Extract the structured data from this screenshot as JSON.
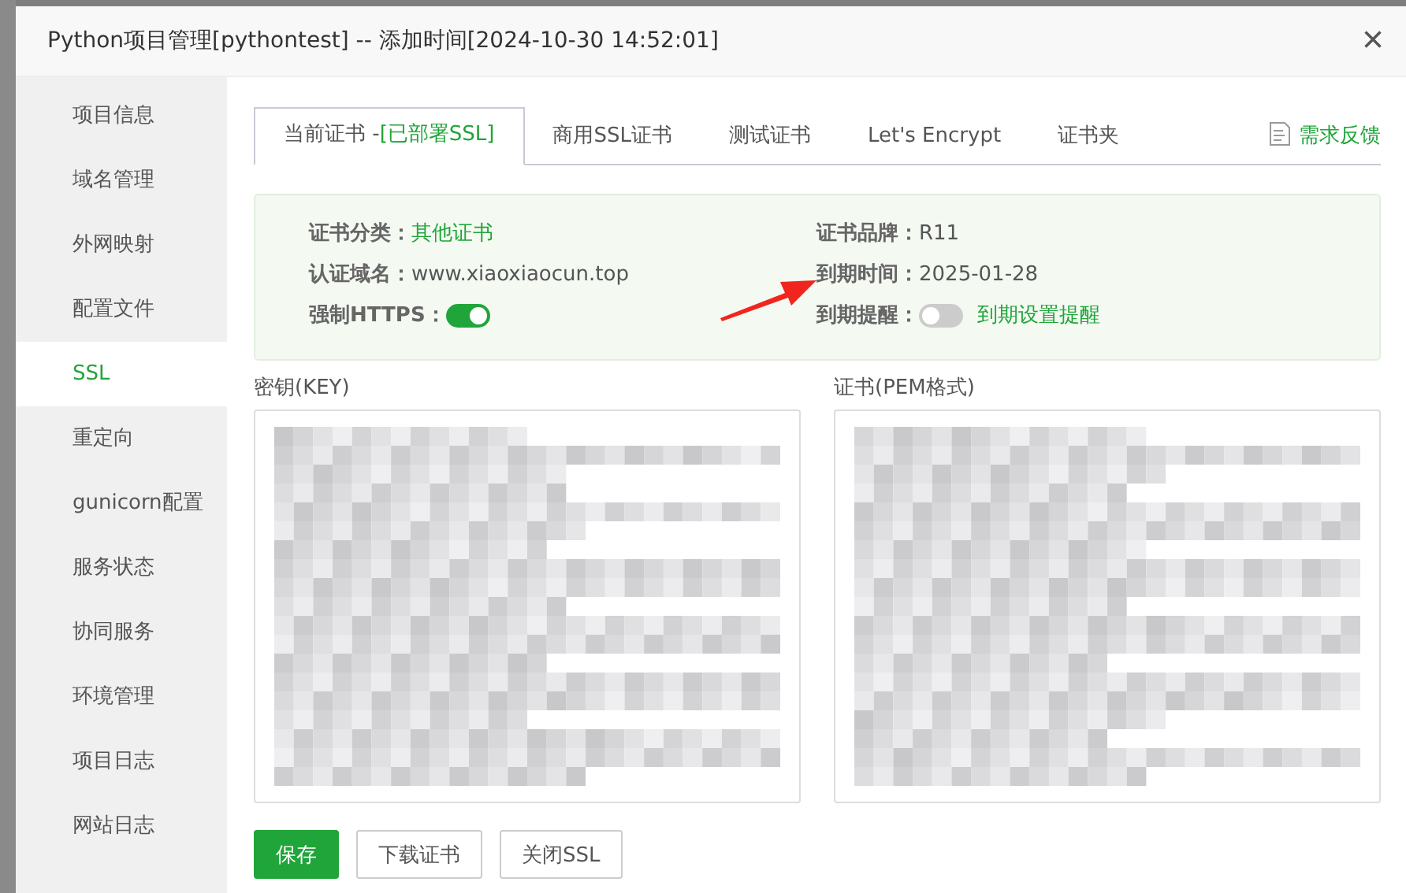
{
  "window": {
    "title": "Python项目管理[pythontest] -- 添加时间[2024-10-30 14:52:01]",
    "close": "×"
  },
  "sidebar": {
    "items": [
      {
        "label": "项目信息",
        "selected": false
      },
      {
        "label": "域名管理",
        "selected": false
      },
      {
        "label": "外网映射",
        "selected": false
      },
      {
        "label": "配置文件",
        "selected": false
      },
      {
        "label": "SSL",
        "selected": true
      },
      {
        "label": "重定向",
        "selected": false
      },
      {
        "label": "gunicorn配置",
        "selected": false
      },
      {
        "label": "服务状态",
        "selected": false
      },
      {
        "label": "协同服务",
        "selected": false
      },
      {
        "label": "环境管理",
        "selected": false
      },
      {
        "label": "项目日志",
        "selected": false
      },
      {
        "label": "网站日志",
        "selected": false
      }
    ]
  },
  "tabs": [
    {
      "label": "当前证书 -",
      "badge": "[已部署SSL]",
      "selected": true
    },
    {
      "label": "商用SSL证书",
      "selected": false
    },
    {
      "label": "测试证书",
      "selected": false
    },
    {
      "label": "Let's Encrypt",
      "selected": false
    },
    {
      "label": "证书夹",
      "selected": false
    }
  ],
  "feedback_link": "需求反馈",
  "info": {
    "left": [
      {
        "kind": "text",
        "label": "证书分类：",
        "value": "其他证书",
        "highlight": true
      },
      {
        "kind": "text",
        "label": "认证域名：",
        "value": "www.xiaoxiaocun.top",
        "highlight": false
      },
      {
        "kind": "toggle",
        "label": "强制HTTPS：",
        "on": true
      }
    ],
    "right": [
      {
        "kind": "text",
        "label": "证书品牌：",
        "value": "R11",
        "highlight": false
      },
      {
        "kind": "text",
        "label": "到期时间：",
        "value": "2025-01-28",
        "highlight": false
      },
      {
        "kind": "toggle",
        "label": "到期提醒：",
        "on": false,
        "link": "到期设置提醒"
      }
    ]
  },
  "key_label": "密钥(KEY)",
  "cert_label": "证书(PEM格式)",
  "buttons": [
    {
      "label": "保存",
      "kind": "primary"
    },
    {
      "label": "下载证书",
      "kind": "default"
    },
    {
      "label": "关闭SSL",
      "kind": "default"
    }
  ]
}
